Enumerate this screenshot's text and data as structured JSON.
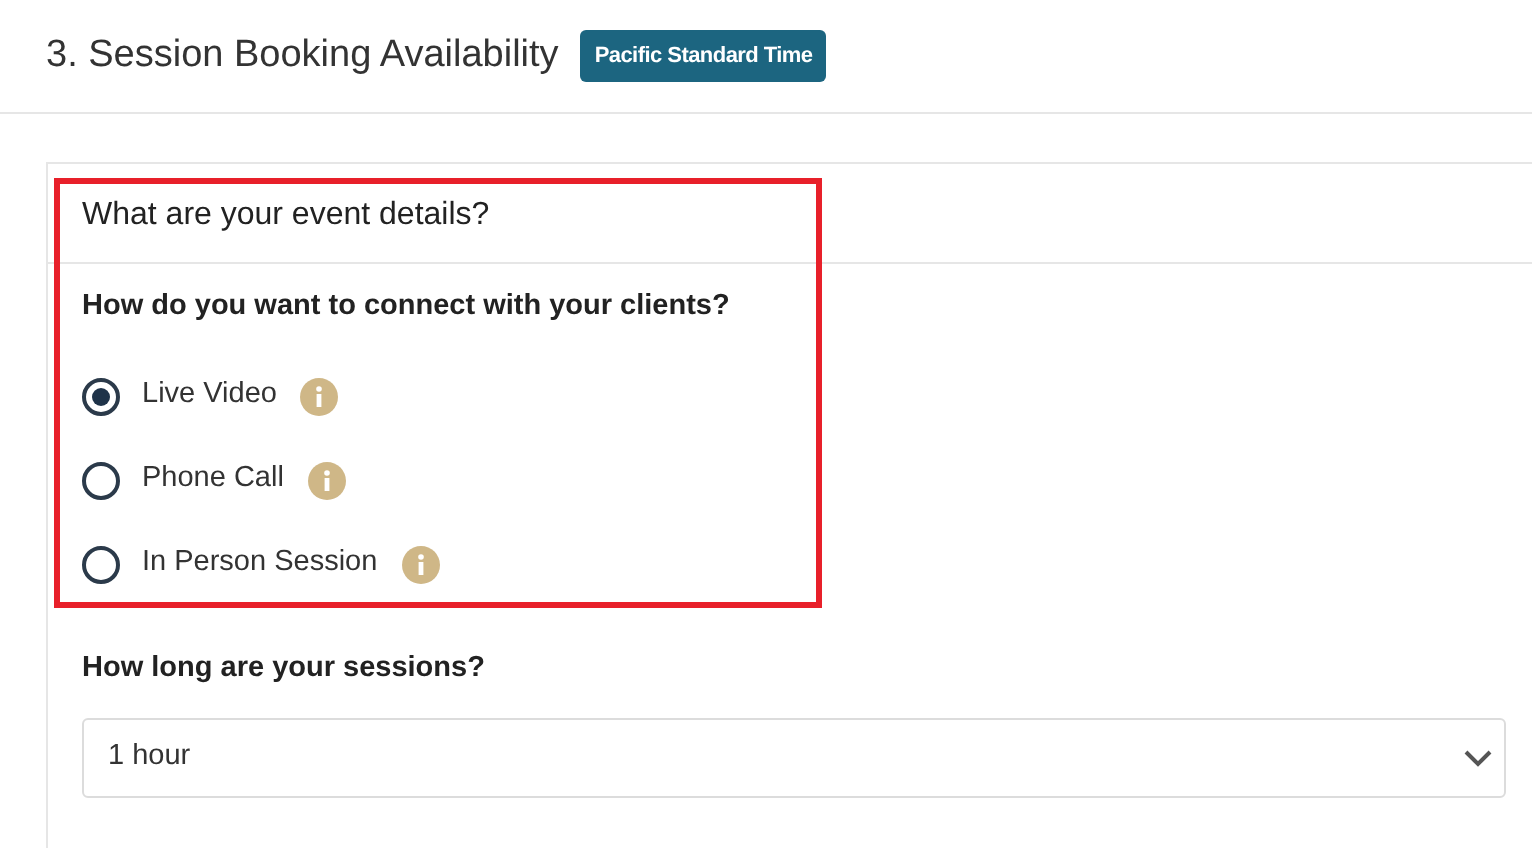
{
  "page": {
    "title": "3. Session Booking Availability",
    "timezone_badge": "Pacific Standard Time"
  },
  "card": {
    "title": "What are your event details?",
    "highlighted": true,
    "connect_question": "How do you want to connect with your clients?",
    "options": [
      {
        "label": "Live Video",
        "selected": true
      },
      {
        "label": "Phone Call",
        "selected": false
      },
      {
        "label": "In Person Session",
        "selected": false
      }
    ],
    "duration_question": "How long are your sessions?",
    "duration_select": {
      "value": "1 hour"
    }
  }
}
